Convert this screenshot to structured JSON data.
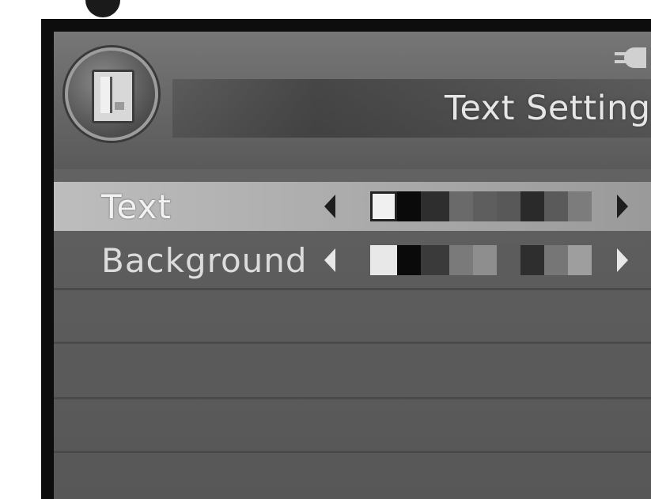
{
  "header": {
    "title": "Text Setting",
    "main_icon": "book-icon",
    "corner_icon": "plug-icon"
  },
  "rows": [
    {
      "label": "Text",
      "highlighted": true,
      "selected_swatch": 0,
      "swatch_colors": [
        "#f0f0f0",
        "#0a0a0a",
        "#2e2e2e",
        "#6a6a6a",
        "#5e5e5e",
        "#585858",
        "#2a2a2a",
        "#5a5a5a",
        "#7c7c7c"
      ]
    },
    {
      "label": "Background",
      "highlighted": false,
      "selected_swatch": 0,
      "swatch_colors": [
        "#e8e8e8",
        "#0a0a0a",
        "#3a3a3a",
        "#7a7a7a",
        "#8e8e8e",
        "#5c5c5c",
        "#2e2e2e",
        "#767676",
        "#9e9e9e"
      ]
    }
  ],
  "colors": {
    "frame": "#0d0d0d",
    "panel": "#5e5e5e",
    "highlight_row": "#b4b4b4"
  }
}
